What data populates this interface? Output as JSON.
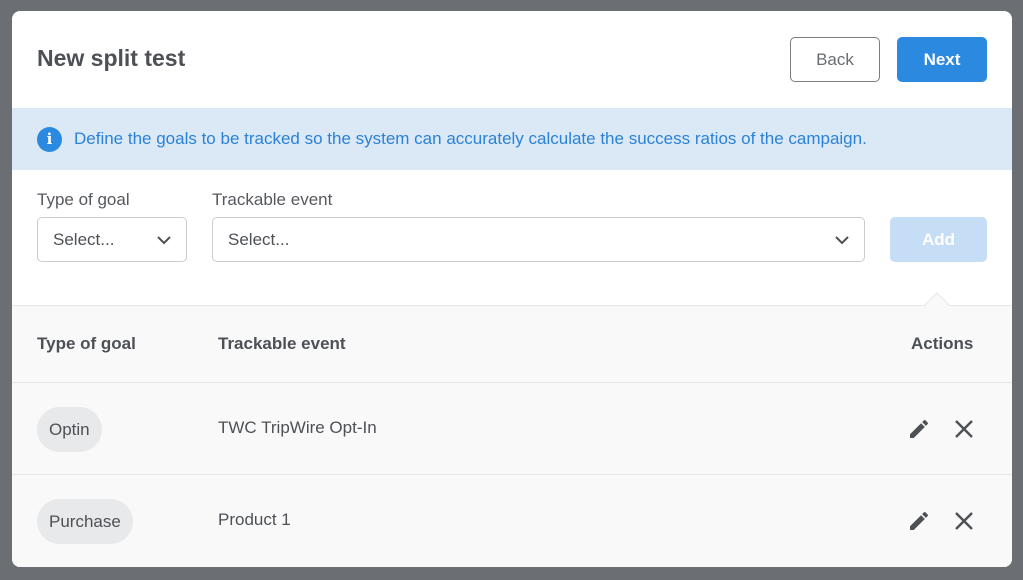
{
  "modal": {
    "title": "New split test",
    "back_label": "Back",
    "next_label": "Next"
  },
  "info": {
    "icon": "info-icon",
    "text": "Define the goals to be tracked so the system can accurately calculate the success ratios of the campaign."
  },
  "form": {
    "goal_type_label": "Type of goal",
    "goal_type_value": "Select...",
    "event_label": "Trackable event",
    "event_value": "Select...",
    "add_label": "Add"
  },
  "table": {
    "headers": {
      "goal_type": "Type of goal",
      "event": "Trackable event",
      "actions": "Actions"
    },
    "rows": [
      {
        "goal_type": "Optin",
        "event": "TWC TripWire Opt-In"
      },
      {
        "goal_type": "Purchase",
        "event": "Product 1"
      }
    ]
  },
  "colors": {
    "primary": "#2b8ae0",
    "banner_bg": "#dbe9f6",
    "add_disabled": "#c5ddf5"
  }
}
